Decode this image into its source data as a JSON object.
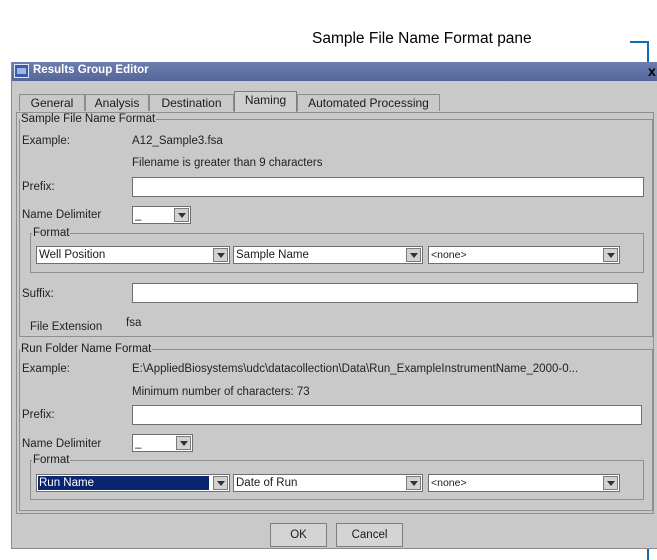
{
  "callout": {
    "label": "Sample File Name Format pane"
  },
  "window": {
    "title": "Results Group Editor",
    "close_glyph": "x",
    "icon": "app-icon"
  },
  "tabs": [
    {
      "label": "General"
    },
    {
      "label": "Analysis"
    },
    {
      "label": "Destination"
    },
    {
      "label": "Naming",
      "active": true
    },
    {
      "label": "Automated Processing"
    }
  ],
  "sample_section": {
    "title": "Sample File Name Format",
    "example_label": "Example:",
    "example_value": "A12_Sample3.fsa",
    "note": "Filename is greater than 9 characters",
    "prefix_label": "Prefix:",
    "prefix_value": "",
    "delimiter_label": "Name Delimiter",
    "delimiter_value": "_",
    "format_title": "Format",
    "format_fields": [
      "Well Position",
      "Sample Name",
      "<none>"
    ],
    "suffix_label": "Suffix:",
    "suffix_value": "",
    "extension_label": "File Extension",
    "extension_value": "fsa"
  },
  "run_section": {
    "title": "Run Folder Name Format",
    "example_label": "Example:",
    "example_value": "E:\\AppliedBiosystems\\udc\\datacollection\\Data\\Run_ExampleInstrumentName_2000-0...",
    "note": "Minimum number of characters: 73",
    "prefix_label": "Prefix:",
    "prefix_value": "",
    "delimiter_label": "Name Delimiter",
    "delimiter_value": "_",
    "format_title": "Format",
    "format_fields": [
      "Run Name",
      "Date of Run",
      "<none>"
    ]
  },
  "buttons": {
    "ok": "OK",
    "cancel": "Cancel"
  }
}
